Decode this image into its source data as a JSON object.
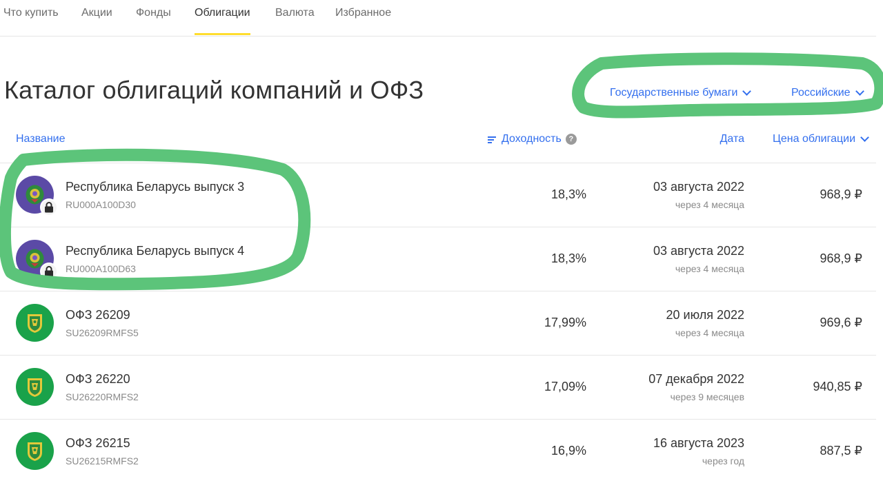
{
  "nav": {
    "tabs": [
      {
        "label": "Что купить",
        "active": false
      },
      {
        "label": "Акции",
        "active": false
      },
      {
        "label": "Фонды",
        "active": false
      },
      {
        "label": "Облигации",
        "active": true
      },
      {
        "label": "Валюта",
        "active": false
      },
      {
        "label": "Избранное",
        "active": false
      }
    ]
  },
  "title": "Каталог облигаций компаний и ОФЗ",
  "filters": {
    "type": "Государственные бумаги",
    "origin": "Российские"
  },
  "table": {
    "headers": {
      "name": "Название",
      "yield": "Доходность",
      "date": "Дата",
      "price": "Цена облигации"
    },
    "rows": [
      {
        "name": "Республика Беларусь выпуск 3",
        "isin": "RU000A100D30",
        "yield": "18,3%",
        "date": "03 августа 2022",
        "date_note": "через 4 месяца",
        "price": "968,9 ₽",
        "logo": "belarus-emblem-icon",
        "locked": true
      },
      {
        "name": "Республика Беларусь выпуск 4",
        "isin": "RU000A100D63",
        "yield": "18,3%",
        "date": "03 августа 2022",
        "date_note": "через 4 месяца",
        "price": "968,9 ₽",
        "logo": "belarus-emblem-icon",
        "locked": true
      },
      {
        "name": "ОФЗ 26209",
        "isin": "SU26209RMFS5",
        "yield": "17,99%",
        "date": "20 июля 2022",
        "date_note": "через 4 месяца",
        "price": "969,6 ₽",
        "logo": "minfin-emblem-icon",
        "locked": false
      },
      {
        "name": "ОФЗ 26220",
        "isin": "SU26220RMFS2",
        "yield": "17,09%",
        "date": "07 декабря 2022",
        "date_note": "через 9 месяцев",
        "price": "940,85 ₽",
        "logo": "minfin-emblem-icon",
        "locked": false
      },
      {
        "name": "ОФЗ 26215",
        "isin": "SU26215RMFS2",
        "yield": "16,9%",
        "date": "16 августа 2023",
        "date_note": "через год",
        "price": "887,5 ₽",
        "logo": "minfin-emblem-icon",
        "locked": false
      }
    ]
  },
  "colors": {
    "link": "#336fee",
    "active_tab_underline": "#ffdd2d",
    "annotation_marker": "#5cc47a",
    "belarus_logo_bg": "#5b4aa6",
    "minfin_logo_bg": "#1aa24a"
  }
}
